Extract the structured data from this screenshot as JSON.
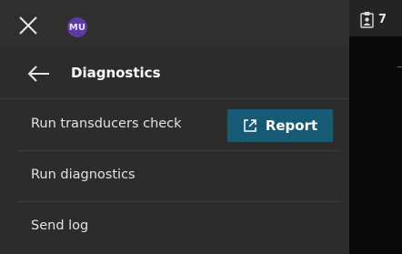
{
  "topbar": {
    "close_icon": "close-icon",
    "avatar_initials": "MU",
    "avatar_color": "#5b3ba3"
  },
  "header": {
    "back_icon": "arrow-left-icon",
    "title": "Diagnostics"
  },
  "items": [
    {
      "label": "Run transducers check"
    },
    {
      "label": "Run diagnostics"
    },
    {
      "label": "Send log"
    }
  ],
  "report_button": {
    "icon": "external-link-icon",
    "label": "Report",
    "color": "#175a75"
  },
  "right_panel": {
    "clipboard_icon": "clipboard-user-icon",
    "count": "7"
  }
}
